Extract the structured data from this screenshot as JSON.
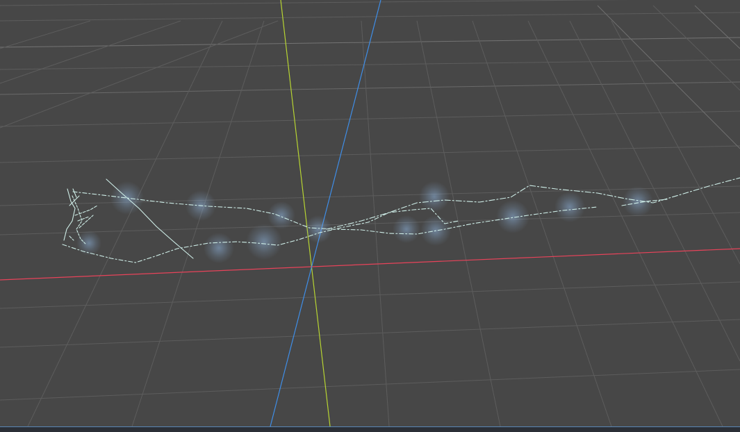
{
  "app": {
    "view": "3d-viewport",
    "background_color": "#474747"
  },
  "grid": {
    "visible": true,
    "color": "#5e5e5e"
  },
  "axes": {
    "x_axis_color": "#e8435a",
    "y_axis_color": "#b7d432",
    "z_axis_color": "#3f8ee8"
  },
  "trajectory": {
    "color": "#cfeee8",
    "marker_color": "#8fb4dd"
  },
  "status_bar": {
    "color": "#2b2f36",
    "accent": "#5a86b5"
  }
}
